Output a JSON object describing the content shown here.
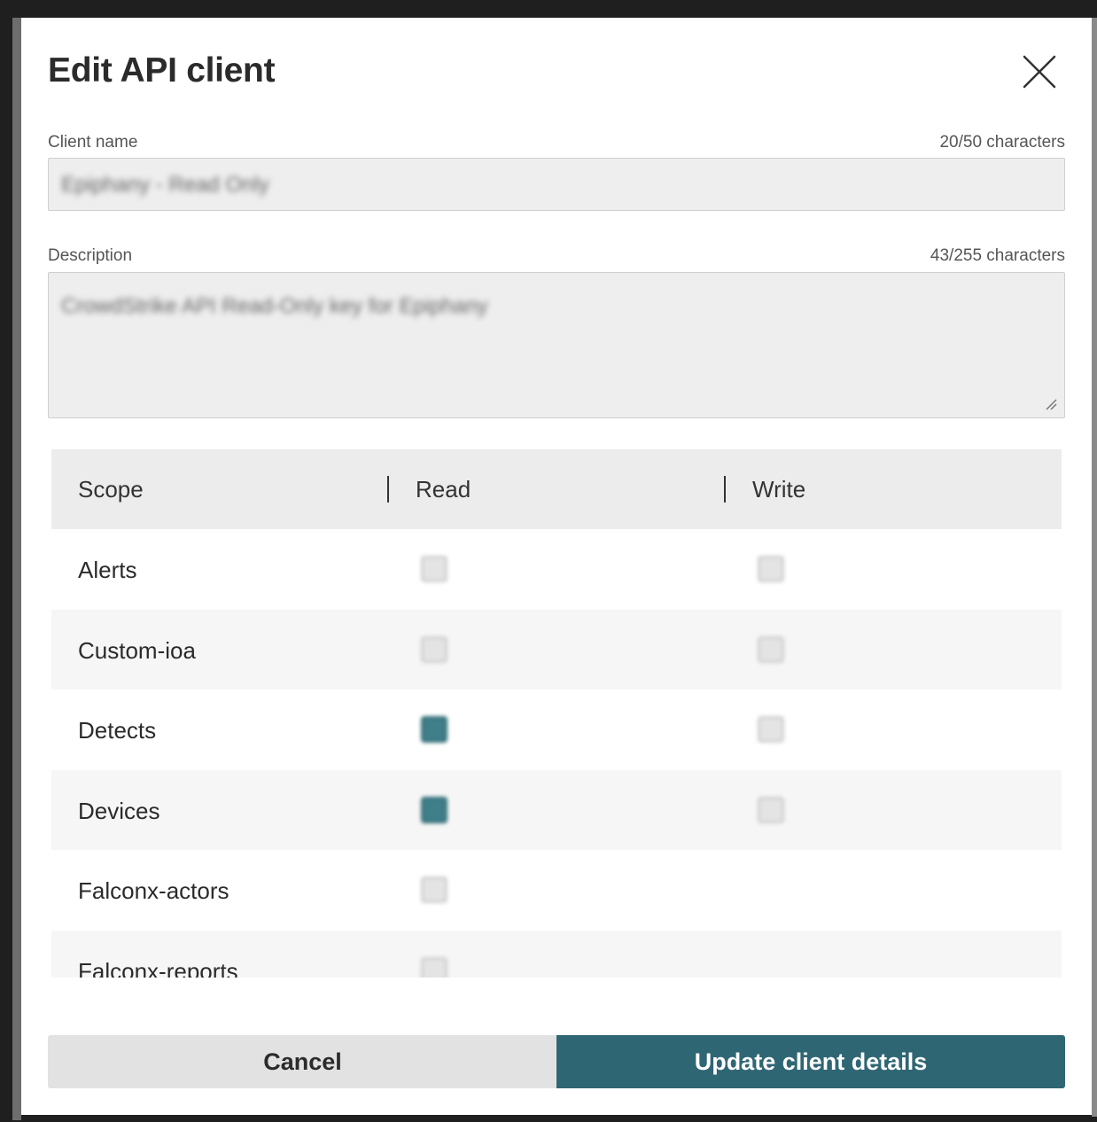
{
  "dialog": {
    "title": "Edit API client",
    "close_icon": "close-x-icon"
  },
  "client_name": {
    "label": "Client name",
    "char_count": "20/50 characters",
    "value": "Epiphany - Read Only"
  },
  "description": {
    "label": "Description",
    "char_count": "43/255 characters",
    "value": "CrowdStrike API Read-Only key for Epiphany"
  },
  "scope_table": {
    "headers": {
      "scope": "Scope",
      "read": "Read",
      "write": "Write"
    },
    "rows": [
      {
        "scope": "Alerts",
        "read": false,
        "write": false
      },
      {
        "scope": "Custom-ioa",
        "read": false,
        "write": false
      },
      {
        "scope": "Detects",
        "read": true,
        "write": false
      },
      {
        "scope": "Devices",
        "read": true,
        "write": false
      },
      {
        "scope": "Falconx-actors",
        "read": false,
        "write": null
      },
      {
        "scope": "Falconx-reports",
        "read": false,
        "write": null
      }
    ]
  },
  "footer": {
    "cancel_label": "Cancel",
    "update_label": "Update client details"
  },
  "colors": {
    "primary": "#2f6674",
    "checked": "#3f7f8a"
  }
}
